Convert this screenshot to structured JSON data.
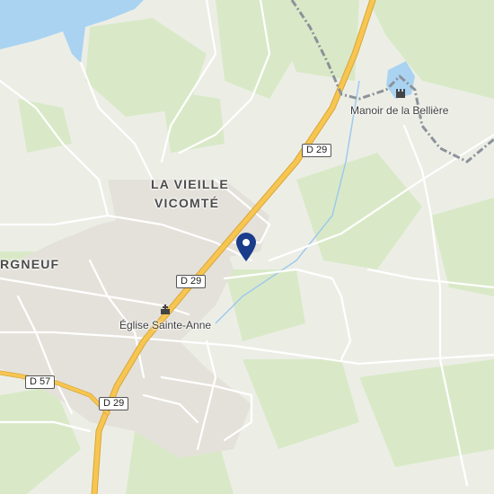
{
  "places": {
    "village": "LA VIEILLE\nVICOMTÉ",
    "village_line1": "LA VIEILLE",
    "village_line2": "VICOMTÉ",
    "town_partial": "RGNEUF"
  },
  "pois": {
    "church": "Église Sainte-Anne",
    "manor": "Manoir de la Bellière"
  },
  "roads": {
    "d29_a": "D 29",
    "d29_b": "D 29",
    "d29_c": "D 29",
    "d57": "D 57"
  },
  "icons": {
    "church": "church-icon",
    "manor": "castle-icon",
    "marker": "location-pin-icon"
  },
  "colors": {
    "background": "#eceee6",
    "water": "#aad3f2",
    "green": "#d8e8c7",
    "main_road": "#f7c650",
    "boundary": "#8c929a",
    "marker": "#1a3c8a"
  }
}
